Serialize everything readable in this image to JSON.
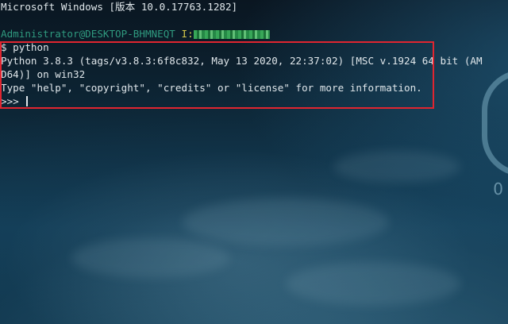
{
  "terminal": {
    "header_line": "Microsoft Windows [版本 10.0.17763.1282]",
    "prompt_user": "Administrator@DESKTOP-BHMNEQT",
    "prompt_path": "I:",
    "command": "$ python",
    "output": [
      "Python 3.8.3 (tags/v3.8.3:6f8c832, May 13 2020, 22:37:02) [MSC v.1924 64 bit (AM",
      "D64)] on win32",
      "Type \"help\", \"copyright\", \"credits\" or \"license\" for more information."
    ],
    "repl_prompt": ">>> "
  },
  "decor": {
    "zero_glyph": "0"
  },
  "colors": {
    "highlight_border": "#e02530",
    "prompt_user": "#2f9a7f",
    "prompt_path": "#d6c84a"
  }
}
